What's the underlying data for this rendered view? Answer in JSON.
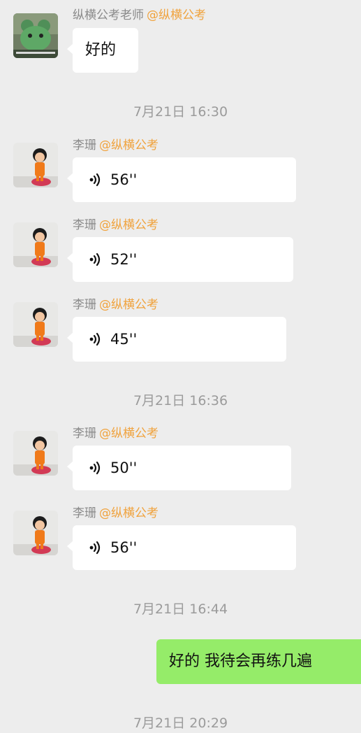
{
  "first": {
    "sender": "纵横公考老师",
    "org": "@纵横公考",
    "text": "好的"
  },
  "times": [
    "7月21日 16:30",
    "7月21日 16:36",
    "7月21日 16:44",
    "7月21日 20:29"
  ],
  "voices": [
    {
      "sender": "李珊",
      "org": "@纵横公考",
      "duration": "56''"
    },
    {
      "sender": "李珊",
      "org": "@纵横公考",
      "duration": "52''"
    },
    {
      "sender": "李珊",
      "org": "@纵横公考",
      "duration": "45''"
    },
    {
      "sender": "李珊",
      "org": "@纵横公考",
      "duration": "50''"
    },
    {
      "sender": "李珊",
      "org": "@纵横公考",
      "duration": "56''"
    }
  ],
  "mine": {
    "text": "好的 我待会再练几遍"
  },
  "colors": {
    "background": "#ededed",
    "bubble_in": "#ffffff",
    "bubble_out": "#95ec69",
    "org_tag": "#f0a23c"
  }
}
